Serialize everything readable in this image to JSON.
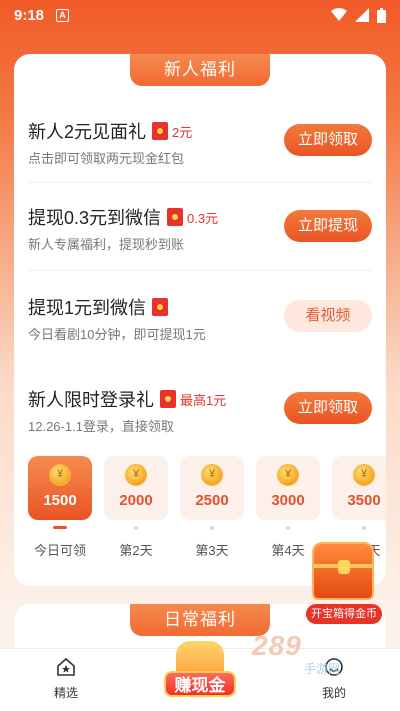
{
  "status_bar": {
    "time": "9:18",
    "notification_badge": "A"
  },
  "welfare_card": {
    "title": "新人福利",
    "tasks": [
      {
        "title": "新人2元见面礼",
        "reward": "2元",
        "sub": "点击即可领取两元现金红包",
        "button": "立即领取",
        "button_style": "primary"
      },
      {
        "title": "提现0.3元到微信",
        "reward": "0.3元",
        "sub": "新人专属福利，提现秒到账",
        "button": "立即提现",
        "button_style": "primary"
      },
      {
        "title": "提现1元到微信",
        "reward": "",
        "sub": "今日看剧10分钟，即可提现1元",
        "button": "看视频",
        "button_style": "light"
      },
      {
        "title": "新人限时登录礼",
        "reward": "最高1元",
        "sub": "12.26-1.1登录，直接领取",
        "button": "立即领取",
        "button_style": "primary"
      }
    ],
    "checkin": {
      "coin_symbol": "¥",
      "days": [
        {
          "amount": "1500",
          "label": "今日可领",
          "active": true
        },
        {
          "amount": "2000",
          "label": "第2天",
          "active": false
        },
        {
          "amount": "2500",
          "label": "第3天",
          "active": false
        },
        {
          "amount": "3000",
          "label": "第4天",
          "active": false
        },
        {
          "amount": "3500",
          "label": "第5天",
          "active": false
        }
      ]
    }
  },
  "treasure": {
    "label": "开宝箱得金币"
  },
  "daily_card": {
    "title": "日常福利"
  },
  "bottom_nav": {
    "home_label": "精选",
    "center_label": "赚现金",
    "profile_label": "我的"
  },
  "watermark": {
    "main": "289",
    "sub": "手游网"
  },
  "colors": {
    "accent": "#ea5424",
    "red": "#e8322a"
  }
}
